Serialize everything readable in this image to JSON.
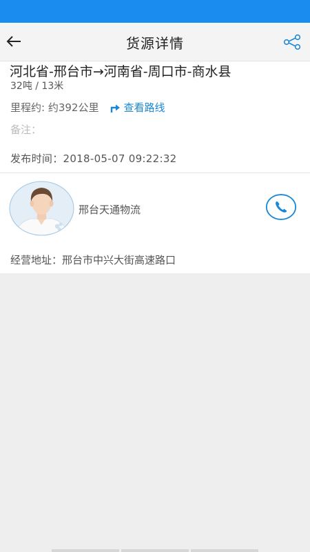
{
  "nav": {
    "title": "货源详情",
    "back_icon": "arrow-left-icon",
    "share_icon": "share-icon"
  },
  "cargo": {
    "route": "河北省-邢台市→河南省-周口市-商水县",
    "weight_length": "32吨 / 13米",
    "mileage": "里程约: 约392公里",
    "route_link_label": "查看路线",
    "remark": "备注：",
    "publish_time": "发布时间：2018-05-07 09:22:32"
  },
  "publisher": {
    "company": "邢台天通物流",
    "address": "经营地址：邢台市中兴大街高速路口",
    "avatar_icon": "user-avatar-icon",
    "phone_icon": "phone-icon"
  },
  "colors": {
    "status_bar": "#1a8cf0",
    "accent": "#1a88d8"
  }
}
